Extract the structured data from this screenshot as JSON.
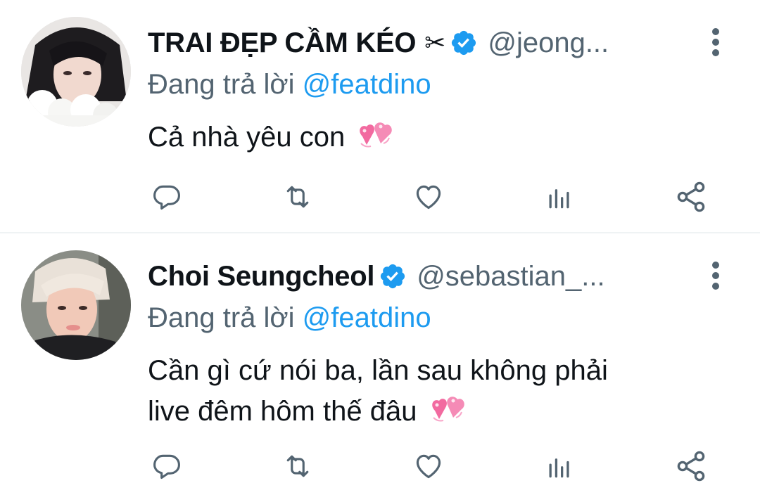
{
  "tweets": [
    {
      "name": "TRAI ĐẸP CẦM KÉO",
      "name_emoji": "✂",
      "handle": "@jeong...",
      "reply_prefix": "Đang trả lời",
      "reply_to": "@featdino",
      "text": "Cả nhà yêu con",
      "verified": true,
      "avatar_icon": "avatar-photo"
    },
    {
      "name": "Choi Seungcheol",
      "name_emoji": "",
      "handle": "@sebastian_...",
      "reply_prefix": "Đang trả lời",
      "reply_to": "@featdino",
      "text_line1": "Cần gì cứ nói ba, lần sau không phải",
      "text_line2": "live đêm hôm thế đâu",
      "verified": true,
      "avatar_icon": "avatar-photo"
    }
  ],
  "actions": [
    "reply-icon",
    "retweet-icon",
    "like-icon",
    "analytics-icon",
    "share-icon"
  ],
  "colors": {
    "text": "#0f1419",
    "secondary": "#536471",
    "accent": "#1d9bf0",
    "divider": "#eff3f4",
    "heart_emoji": "#f06aa0"
  }
}
